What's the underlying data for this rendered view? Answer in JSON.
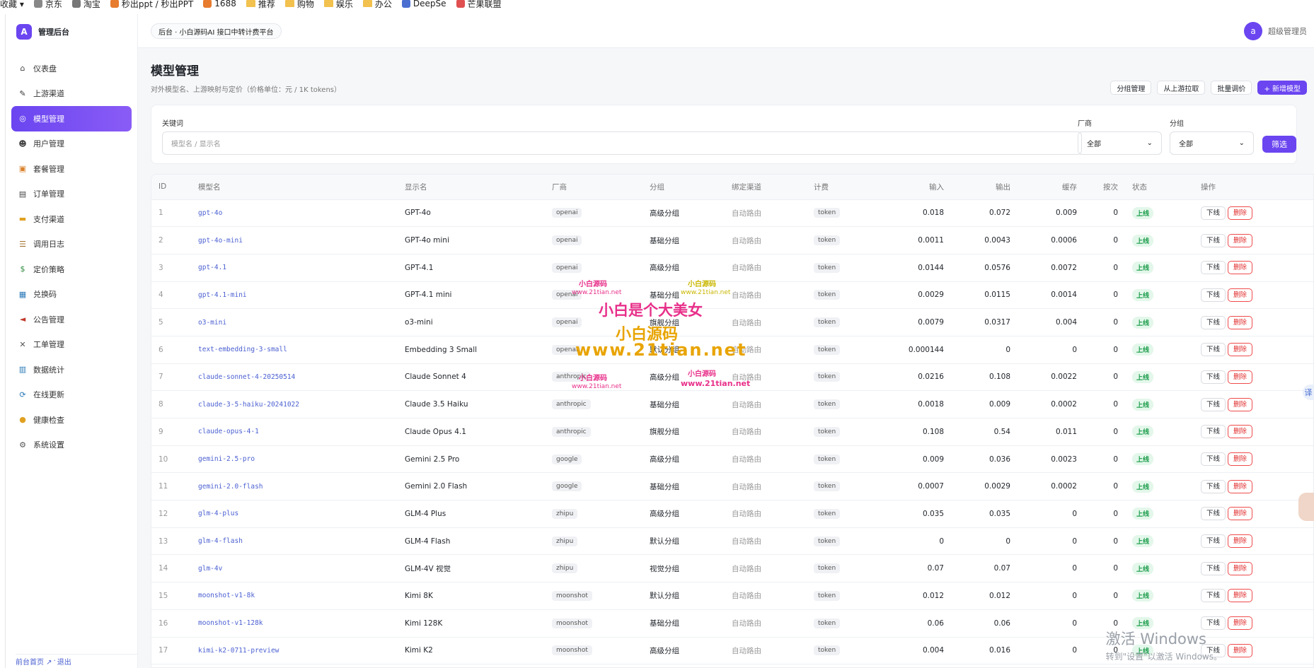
{
  "bookmarks": [
    "收藏 ▾",
    "京东",
    "淘宝",
    "秒出ppt / 秒出PPT",
    "1688",
    "推荐",
    "购物",
    "娱乐",
    "办公",
    "DeepSe",
    "芒果联盟"
  ],
  "brand": {
    "logo_letter": "A",
    "name": "管理后台",
    "accent": "#6a45f0"
  },
  "nav": [
    {
      "label": "仪表盘",
      "icon": "home-icon"
    },
    {
      "label": "上游渠道",
      "icon": "plug-icon"
    },
    {
      "label": "模型管理",
      "icon": "model-icon",
      "active": true
    },
    {
      "label": "用户管理",
      "icon": "users-icon"
    },
    {
      "label": "套餐管理",
      "icon": "package-icon"
    },
    {
      "label": "订单管理",
      "icon": "order-icon"
    },
    {
      "label": "支付渠道",
      "icon": "card-icon"
    },
    {
      "label": "调用日志",
      "icon": "log-icon"
    },
    {
      "label": "定价策略",
      "icon": "price-icon"
    },
    {
      "label": "兑换码",
      "icon": "ticket-icon"
    },
    {
      "label": "公告管理",
      "icon": "megaphone-icon"
    },
    {
      "label": "工单管理",
      "icon": "tools-icon"
    },
    {
      "label": "数据统计",
      "icon": "chart-icon"
    },
    {
      "label": "在线更新",
      "icon": "update-icon"
    },
    {
      "label": "健康检查",
      "icon": "bulb-icon"
    },
    {
      "label": "系统设置",
      "icon": "gear-icon"
    }
  ],
  "footer": {
    "home": "前台首页 ↗",
    "sep": " · ",
    "logout": "退出"
  },
  "header": {
    "breadcrumb": "后台 · 小白源码AI 接口中转计费平台",
    "avatar_letter": "a",
    "username": "超级管理员"
  },
  "page": {
    "title": "模型管理",
    "subtitle": "对外模型名、上游映射与定价（价格单位：元 / 1K tokens）"
  },
  "actions": {
    "group": "分组管理",
    "pull": "从上游拉取",
    "batch": "批量调价",
    "add": "+ 新增模型"
  },
  "filter": {
    "keyword_label": "关键词",
    "keyword_placeholder": "模型名 / 显示名",
    "vendor_label": "厂商",
    "vendor_value": "全部",
    "group_label": "分组",
    "group_value": "全部",
    "submit": "筛选"
  },
  "table": {
    "headers": [
      "ID",
      "模型名",
      "显示名",
      "厂商",
      "分组",
      "绑定渠道",
      "计费",
      "输入",
      "输出",
      "缓存",
      "按次",
      "状态",
      "操作"
    ],
    "status_label": "上线",
    "offline_label": "下线",
    "delete_label": "删除",
    "rows": [
      [
        "1",
        "gpt-4o",
        "GPT-4o",
        "openai",
        "高级分组",
        "自动路由",
        "token",
        "0.018",
        "0.072",
        "0.009",
        "0"
      ],
      [
        "2",
        "gpt-4o-mini",
        "GPT-4o mini",
        "openai",
        "基础分组",
        "自动路由",
        "token",
        "0.0011",
        "0.0043",
        "0.0006",
        "0"
      ],
      [
        "3",
        "gpt-4.1",
        "GPT-4.1",
        "openai",
        "高级分组",
        "自动路由",
        "token",
        "0.0144",
        "0.0576",
        "0.0072",
        "0"
      ],
      [
        "4",
        "gpt-4.1-mini",
        "GPT-4.1 mini",
        "openai",
        "基础分组",
        "自动路由",
        "token",
        "0.0029",
        "0.0115",
        "0.0014",
        "0"
      ],
      [
        "5",
        "o3-mini",
        "o3-mini",
        "openai",
        "旗舰分组",
        "自动路由",
        "token",
        "0.0079",
        "0.0317",
        "0.004",
        "0"
      ],
      [
        "6",
        "text-embedding-3-small",
        "Embedding 3 Small",
        "openai",
        "默认分组",
        "自动路由",
        "token",
        "0.000144",
        "0",
        "0",
        "0"
      ],
      [
        "7",
        "claude-sonnet-4-20250514",
        "Claude Sonnet 4",
        "anthropic",
        "高级分组",
        "自动路由",
        "token",
        "0.0216",
        "0.108",
        "0.0022",
        "0"
      ],
      [
        "8",
        "claude-3-5-haiku-20241022",
        "Claude 3.5 Haiku",
        "anthropic",
        "基础分组",
        "自动路由",
        "token",
        "0.0018",
        "0.009",
        "0.0002",
        "0"
      ],
      [
        "9",
        "claude-opus-4-1",
        "Claude Opus 4.1",
        "anthropic",
        "旗舰分组",
        "自动路由",
        "token",
        "0.108",
        "0.54",
        "0.011",
        "0"
      ],
      [
        "10",
        "gemini-2.5-pro",
        "Gemini 2.5 Pro",
        "google",
        "高级分组",
        "自动路由",
        "token",
        "0.009",
        "0.036",
        "0.0023",
        "0"
      ],
      [
        "11",
        "gemini-2.0-flash",
        "Gemini 2.0 Flash",
        "google",
        "基础分组",
        "自动路由",
        "token",
        "0.0007",
        "0.0029",
        "0.0002",
        "0"
      ],
      [
        "12",
        "glm-4-plus",
        "GLM-4 Plus",
        "zhipu",
        "高级分组",
        "自动路由",
        "token",
        "0.035",
        "0.035",
        "0",
        "0"
      ],
      [
        "13",
        "glm-4-flash",
        "GLM-4 Flash",
        "zhipu",
        "默认分组",
        "自动路由",
        "token",
        "0",
        "0",
        "0",
        "0"
      ],
      [
        "14",
        "glm-4v",
        "GLM-4V 视觉",
        "zhipu",
        "视觉分组",
        "自动路由",
        "token",
        "0.07",
        "0.07",
        "0",
        "0"
      ],
      [
        "15",
        "moonshot-v1-8k",
        "Kimi 8K",
        "moonshot",
        "默认分组",
        "自动路由",
        "token",
        "0.012",
        "0.012",
        "0",
        "0"
      ],
      [
        "16",
        "moonshot-v1-128k",
        "Kimi 128K",
        "moonshot",
        "基础分组",
        "自动路由",
        "token",
        "0.06",
        "0.06",
        "0",
        "0"
      ],
      [
        "17",
        "kimi-k2-0711-preview",
        "Kimi K2",
        "moonshot",
        "高级分组",
        "自动路由",
        "token",
        "0.004",
        "0.016",
        "0",
        "0"
      ]
    ]
  },
  "watermarks": {
    "small_cn": "小白源码",
    "small_url": "www.21tian.net",
    "big_slogan": "小白是个大美女",
    "big_cn": "小白源码",
    "big_url": "www.21tian.net"
  },
  "windows_activation": {
    "line1": "激活 Windows",
    "line2": "转到\"设置\"以激活 Windows。"
  },
  "translate_label": "译"
}
